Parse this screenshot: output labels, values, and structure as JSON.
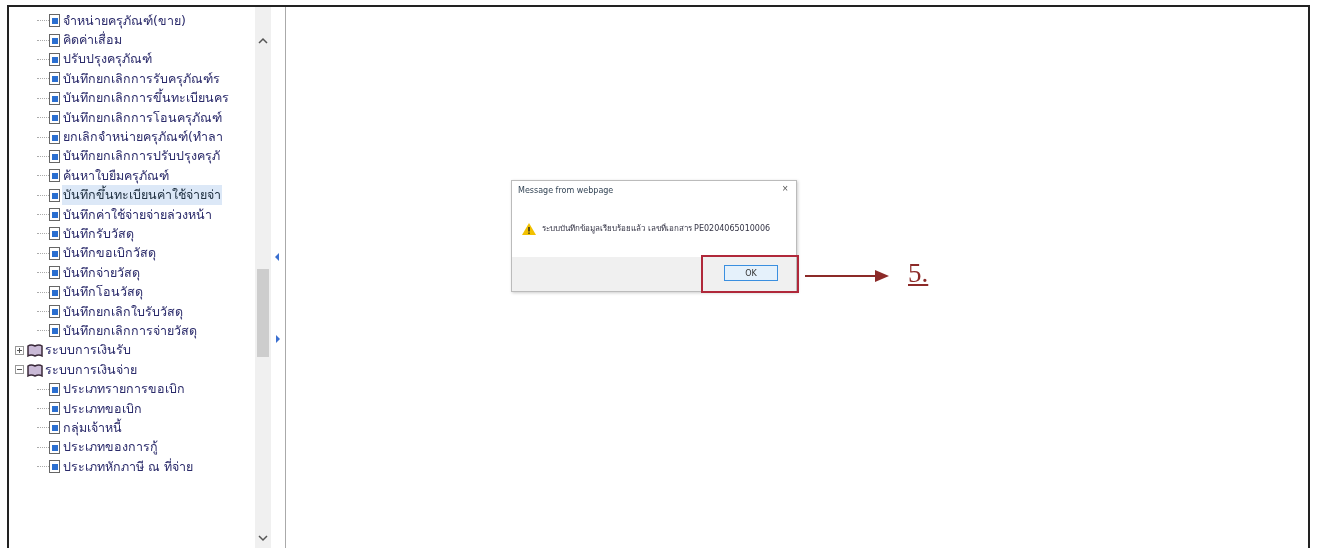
{
  "tree": {
    "scrolled_branch_items": [
      {
        "label": "จำหน่ายครุภัณฑ์(ขาย)",
        "selected": false
      },
      {
        "label": "คิดค่าเสื่อม",
        "selected": false
      },
      {
        "label": "ปรับปรุงครุภัณฑ์",
        "selected": false
      },
      {
        "label": "บันทึกยกเลิกการรับครุภัณฑ์ร",
        "selected": false
      },
      {
        "label": "บันทึกยกเลิกการขึ้นทะเบียนคร",
        "selected": false
      },
      {
        "label": "บันทึกยกเลิกการโอนครุภัณฑ์",
        "selected": false
      },
      {
        "label": "ยกเลิกจำหน่ายครุภัณฑ์(ทำลา",
        "selected": false
      },
      {
        "label": "บันทึกยกเลิกการปรับปรุงครุภั",
        "selected": false
      },
      {
        "label": "ค้นหาใบยืมครุภัณฑ์",
        "selected": false
      },
      {
        "label": "บันทึกขึ้นทะเบียนค่าใช้จ่ายจ่า",
        "selected": true
      },
      {
        "label": "บันทึกค่าใช้จ่ายจ่ายล่วงหน้า",
        "selected": false
      },
      {
        "label": "บันทึกรับวัสดุ",
        "selected": false
      },
      {
        "label": "บันทึกขอเบิกวัสดุ",
        "selected": false
      },
      {
        "label": "บันทึกจ่ายวัสดุ",
        "selected": false
      },
      {
        "label": "บันทึกโอนวัสดุ",
        "selected": false
      },
      {
        "label": "บันทึกยกเลิกใบรับวัสดุ",
        "selected": false
      },
      {
        "label": "บันทึกยกเลิกการจ่ายวัสดุ",
        "selected": false
      }
    ],
    "nodes": [
      {
        "label": "ระบบการเงินรับ",
        "expanded": false
      },
      {
        "label": "ระบบการเงินจ่าย",
        "expanded": true,
        "children": [
          {
            "label": "ประเภทรายการขอเบิก",
            "selected": false
          },
          {
            "label": "ประเภทขอเบิก",
            "selected": false
          },
          {
            "label": "กลุ่มเจ้าหนี้",
            "selected": false
          },
          {
            "label": "ประเภทของการกู้",
            "selected": false
          },
          {
            "label": "ประเภทหักภาษี ณ ที่จ่าย",
            "selected": false
          }
        ]
      }
    ]
  },
  "dialog": {
    "title": "Message from webpage",
    "close": "×",
    "message": "ระบบบันทึกข้อมูลเรียบร้อยแล้ว เลขที่เอกสาร PE0204065010006",
    "ok": "OK"
  },
  "annotation": {
    "label": "5."
  }
}
